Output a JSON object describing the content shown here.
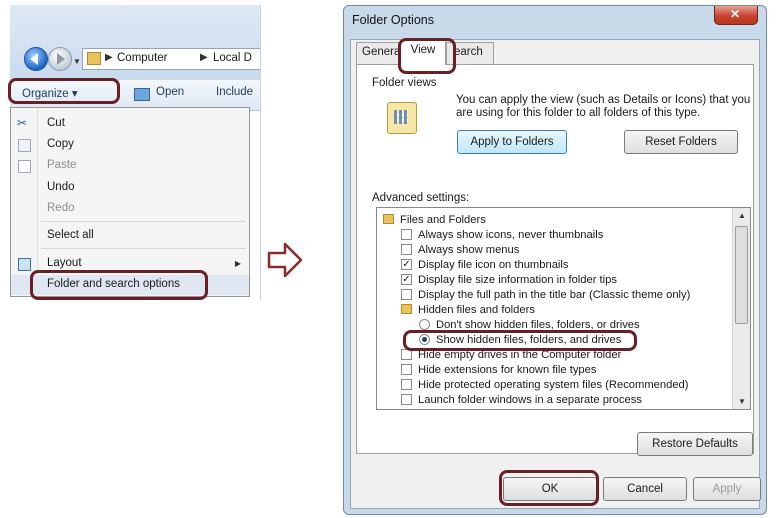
{
  "explorer": {
    "address": [
      "Computer",
      "Local D"
    ],
    "commands": {
      "organize": "Organize ▾",
      "open": "Open",
      "include": "Include"
    },
    "menu": [
      {
        "label": "Cut",
        "enabled": true
      },
      {
        "label": "Copy",
        "enabled": true
      },
      {
        "label": "Paste",
        "enabled": false
      },
      {
        "label": "Undo",
        "enabled": true
      },
      {
        "label": "Redo",
        "enabled": false
      },
      {
        "label": "Select all",
        "enabled": true
      },
      {
        "label": "Layout",
        "enabled": true
      },
      {
        "label": "Folder and search options",
        "enabled": true
      }
    ]
  },
  "dialog": {
    "title": "Folder Options",
    "close_glyph": "✕",
    "tabs": [
      "Genera",
      "View",
      "earch"
    ],
    "folder_views": {
      "title": "Folder views",
      "description": "You can apply the view (such as Details or Icons) that you are using for this folder to all folders of this type.",
      "apply_button": "Apply to Folders",
      "reset_button": "Reset Folders"
    },
    "advanced": {
      "title": "Advanced settings:",
      "items": [
        {
          "kind": "folder",
          "text": "Files and Folders"
        },
        {
          "kind": "check",
          "text": "Always show icons, never thumbnails",
          "checked": false
        },
        {
          "kind": "check",
          "text": "Always show menus",
          "checked": false
        },
        {
          "kind": "check",
          "text": "Display file icon on thumbnails",
          "checked": true
        },
        {
          "kind": "check",
          "text": "Display file size information in folder tips",
          "checked": true
        },
        {
          "kind": "check",
          "text": "Display the full path in the title bar (Classic theme only)",
          "checked": false
        },
        {
          "kind": "folder",
          "text": "Hidden files and folders"
        },
        {
          "kind": "radio",
          "text": "Don't show hidden files, folders, or drives",
          "checked": false
        },
        {
          "kind": "radio",
          "text": "Show hidden files, folders, and drives",
          "checked": true
        },
        {
          "kind": "check",
          "text": "Hide empty drives in the Computer folder",
          "checked": false
        },
        {
          "kind": "check",
          "text": "Hide extensions for known file types",
          "checked": false
        },
        {
          "kind": "check",
          "text": "Hide protected operating system files (Recommended)",
          "checked": false
        },
        {
          "kind": "check",
          "text": "Launch folder windows in a separate process",
          "checked": false
        }
      ]
    },
    "restore_button": "Restore Defaults",
    "ok_button": "OK",
    "cancel_button": "Cancel",
    "apply_button": "Apply"
  },
  "colors": {
    "highlight": "#6b1f24",
    "dialog_frame": "#c8d9ea"
  }
}
